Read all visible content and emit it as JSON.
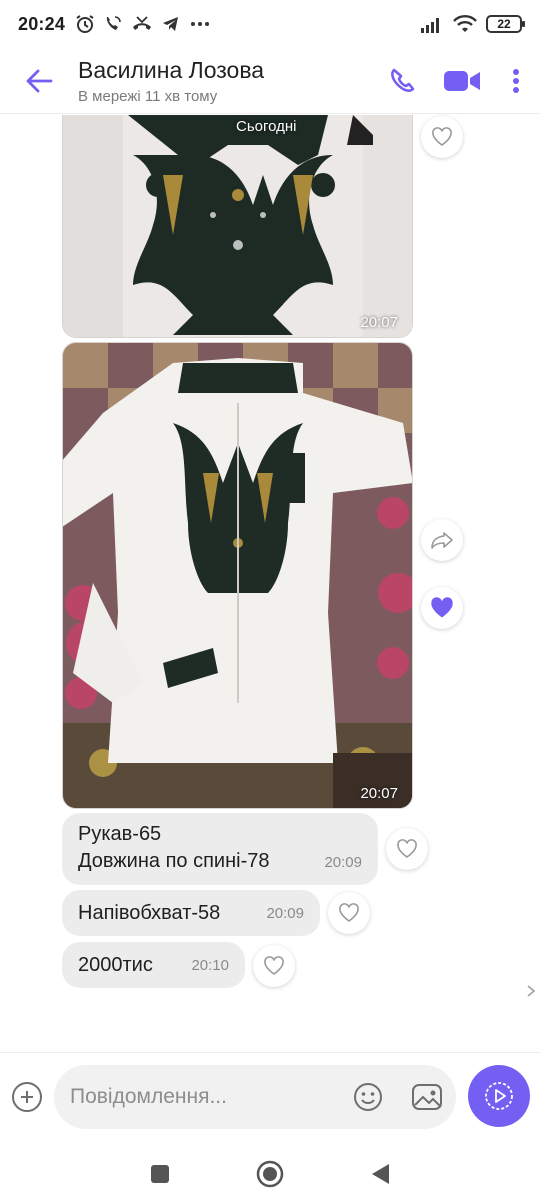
{
  "status": {
    "time": "20:24",
    "battery": "22"
  },
  "header": {
    "contact_name": "Василина Лозова",
    "presence": "В мережі 11 хв тому"
  },
  "chat": {
    "day_label": "Сьогодні",
    "photos": [
      {
        "time": "20:07",
        "liked": false
      },
      {
        "time": "20:07",
        "liked": true
      }
    ],
    "messages": [
      {
        "lines": [
          "Рукав-65",
          "Довжина по спині-78"
        ],
        "time": "20:09"
      },
      {
        "lines": [
          "Напівобхват-58"
        ],
        "time": "20:09"
      },
      {
        "lines": [
          "2000тис"
        ],
        "time": "20:10"
      }
    ]
  },
  "composer": {
    "placeholder": "Повідомлення..."
  },
  "colors": {
    "accent": "#7360f2",
    "bubble": "#ececec"
  }
}
